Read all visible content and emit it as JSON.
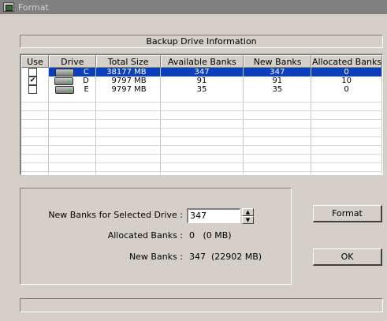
{
  "window": {
    "title": "Format"
  },
  "header": {
    "title": "Backup Drive Information"
  },
  "table": {
    "columns": [
      "Use",
      "Drive",
      "Total Size",
      "Available Banks",
      "New Banks",
      "Allocated Banks"
    ],
    "rows": [
      {
        "checked": false,
        "drive": "C",
        "total": "38177 MB",
        "available": "347",
        "new": "347",
        "allocated": "0",
        "selected": true
      },
      {
        "checked": true,
        "drive": "D",
        "total": "9797 MB",
        "available": "91",
        "new": "91",
        "allocated": "10",
        "selected": false
      },
      {
        "checked": false,
        "drive": "E",
        "total": "9797 MB",
        "available": "35",
        "new": "35",
        "allocated": "0",
        "selected": false
      }
    ]
  },
  "settings": {
    "new_banks_label": "New Banks for Selected Drive :",
    "new_banks_value": "347",
    "allocated_label": "Allocated Banks :",
    "allocated_value": "0   (0 MB)",
    "new_banks_total_label": "New Banks :",
    "new_banks_total_value": "347  (22902 MB)"
  },
  "buttons": {
    "format": "Format",
    "ok": "OK"
  },
  "colors": {
    "selection": "#0a3fbf",
    "face": "#d4d0c8",
    "titlebar": "#808080"
  }
}
